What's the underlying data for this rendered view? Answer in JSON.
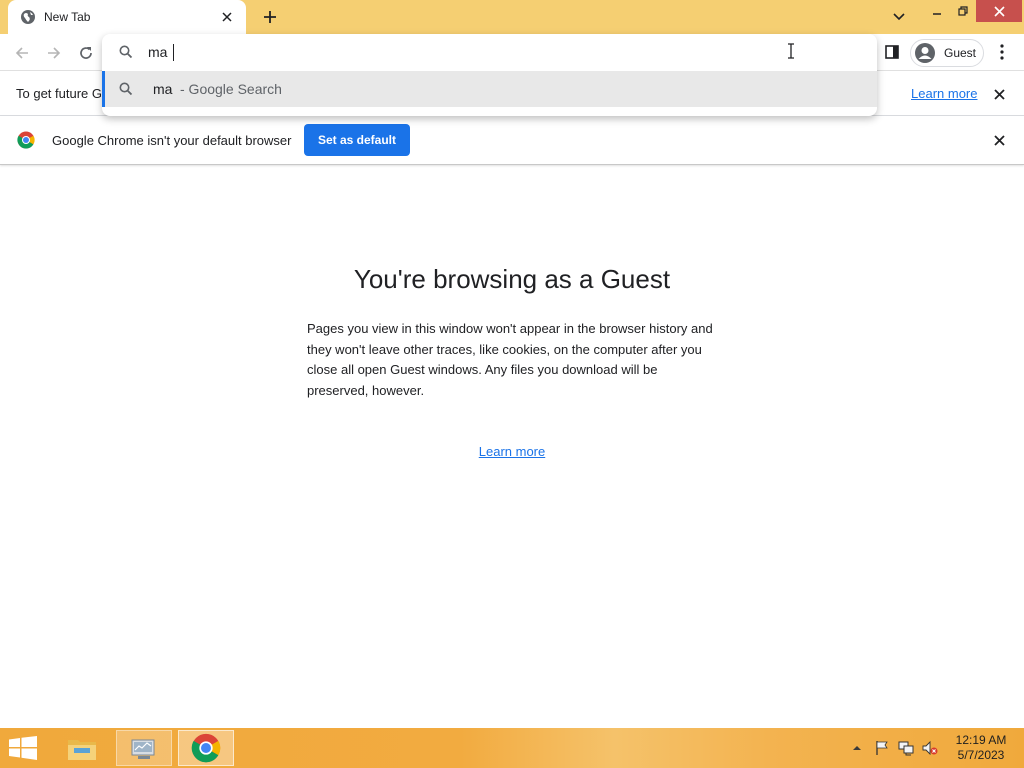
{
  "browser": {
    "tab": {
      "title": "New Tab"
    },
    "omnibox": {
      "value": "ma",
      "suggestion": {
        "query": "ma",
        "description": "- Google Search"
      }
    },
    "profile": {
      "label": "Guest"
    }
  },
  "infobars": {
    "sync": {
      "text": "To get future G",
      "learn_more": "Learn more"
    },
    "default_browser": {
      "text": "Google Chrome isn't your default browser",
      "button": "Set as default"
    }
  },
  "page": {
    "title": "You're browsing as a Guest",
    "description": "Pages you view in this window won't appear in the browser history and they won't leave other traces, like cookies, on the computer after you close all open Guest windows. Any files you download will be preserved, however.",
    "learn_more": "Learn more"
  },
  "taskbar": {
    "clock": {
      "time": "12:19 AM",
      "date": "5/7/2023"
    },
    "items": [
      "file-explorer",
      "server-manager",
      "google-chrome"
    ]
  },
  "colors": {
    "tabstrip": "#f5cf72",
    "accent": "#1a73e8",
    "close_button": "#c7504d",
    "taskbar": "#f0a93c"
  }
}
